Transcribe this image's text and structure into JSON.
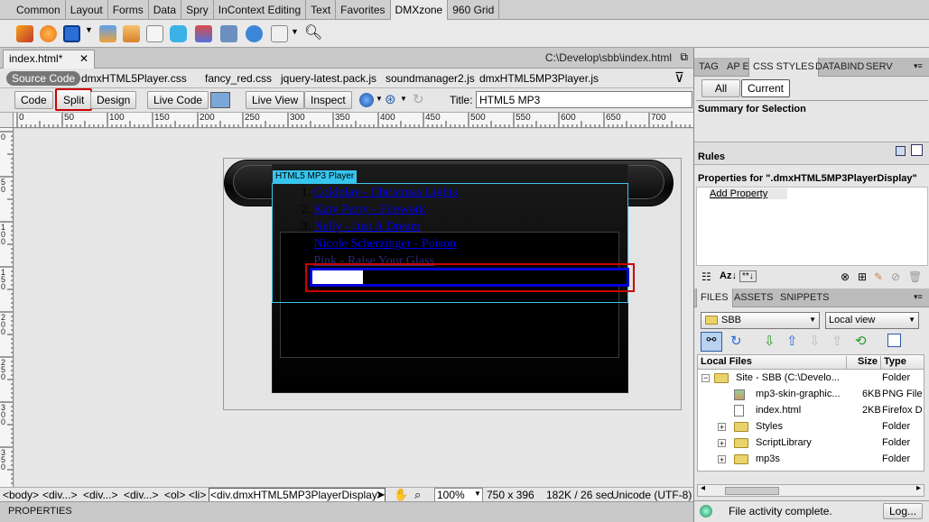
{
  "insert_tabs": [
    "Common",
    "Layout",
    "Forms",
    "Data",
    "Spry",
    "InContext Editing",
    "Text",
    "Favorites",
    "DMXzone",
    "960 Grid"
  ],
  "insert_active": "DMXzone",
  "document": {
    "tab_label": "index.html*",
    "path": "C:\\Develop\\sbb\\index.html"
  },
  "related_files": {
    "source_code": "Source Code",
    "files": [
      "dmxHTML5Player.css",
      "fancy_red.css",
      "jquery-latest.pack.js",
      "soundmanager2.js",
      "dmxHTML5MP3Player.js"
    ]
  },
  "doc_toolbar": {
    "code": "Code",
    "split": "Split",
    "design": "Design",
    "live_code": "Live Code",
    "live_view": "Live View",
    "inspect": "Inspect",
    "title_label": "Title:",
    "title_value": "HTML5 MP3"
  },
  "ruler": {
    "h_labels": [
      "0",
      "50",
      "100",
      "150",
      "200",
      "250",
      "300",
      "350",
      "400",
      "450",
      "500",
      "550",
      "600",
      "650",
      "700"
    ],
    "v_labels": [
      "0",
      "50",
      "100",
      "150",
      "200",
      "250",
      "300",
      "350"
    ]
  },
  "design_view": {
    "div_label": "HTML5 MP3 Player",
    "playlist": [
      {
        "num": "1.",
        "title": "Coldplay - Christmas Lights"
      },
      {
        "num": "2.",
        "title": "Katy Perry - Firework"
      },
      {
        "num": "3.",
        "title": "Nelly - Just A Dream"
      },
      {
        "num": "",
        "title": "Nicole Scherzinger - Poison"
      },
      {
        "num": "",
        "title": "Pink - Raise Your Glass"
      }
    ],
    "progress_fraction": 0.16
  },
  "status_bar": {
    "tags": [
      "<body>",
      "<div...>",
      "<div...>",
      "<div...>",
      "<ol>",
      "<li>",
      "<div.dmxHTML5MP3PlayerDisplay>"
    ],
    "zoom": "100%",
    "window_size": "750 x 396",
    "download": "182K / 26 sec",
    "encoding": "Unicode (UTF-8)"
  },
  "properties_label": "PROPERTIES",
  "css_panel": {
    "tabs": [
      "TAG",
      "AP E",
      "CSS STYLES",
      "DATA",
      "BIND",
      "SERV"
    ],
    "active": "CSS STYLES",
    "all_btn": "All",
    "current_btn": "Current",
    "summary_heading": "Summary for Selection",
    "rules_heading": "Rules",
    "properties_for": "Properties for \".dmxHTML5MP3PlayerDisplay\"",
    "add_property": "Add Property"
  },
  "files_panel": {
    "tabs": [
      "FILES",
      "ASSETS",
      "SNIPPETS"
    ],
    "site_select": "SBB",
    "view_select": "Local view",
    "columns": {
      "name": "Local Files",
      "size": "Size",
      "type": "Type"
    },
    "rows": [
      {
        "name": "Site - SBB (C:\\Develo...",
        "size": "",
        "type": "Folder"
      },
      {
        "name": "mp3-skin-graphic...",
        "size": "6KB",
        "type": "PNG File"
      },
      {
        "name": "index.html",
        "size": "2KB",
        "type": "Firefox D"
      },
      {
        "name": "Styles",
        "size": "",
        "type": "Folder"
      },
      {
        "name": "ScriptLibrary",
        "size": "",
        "type": "Folder"
      },
      {
        "name": "mp3s",
        "size": "",
        "type": "Folder"
      }
    ],
    "status": "File activity complete.",
    "log_btn": "Log..."
  }
}
